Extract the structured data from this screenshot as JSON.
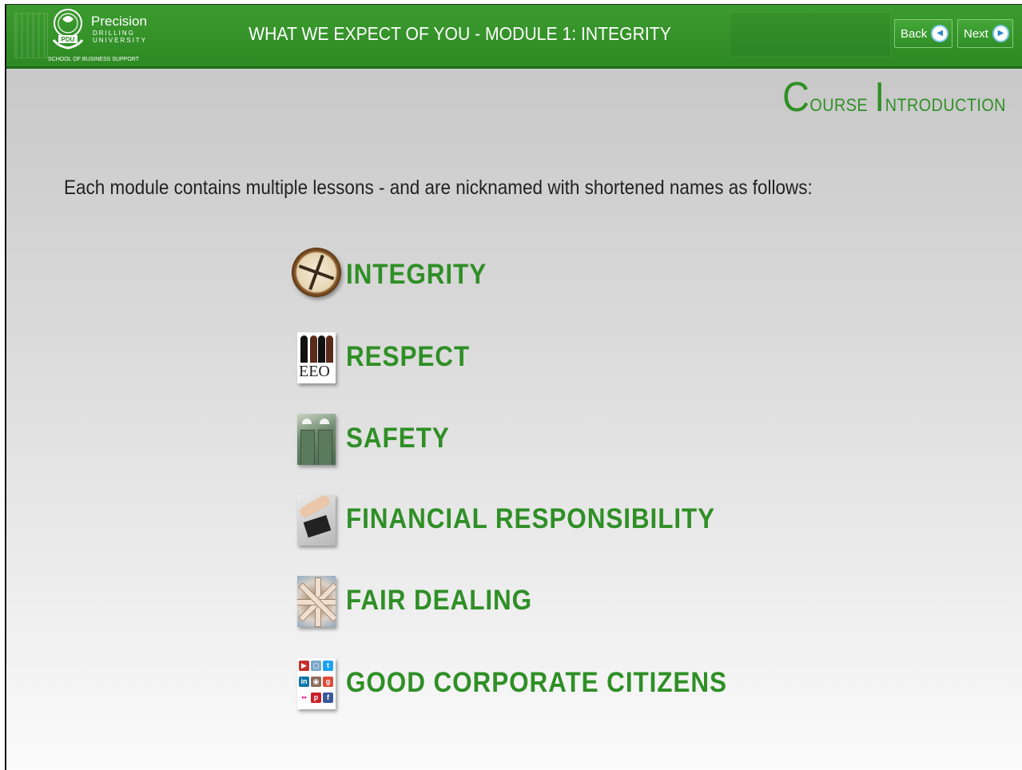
{
  "header": {
    "logo": {
      "name": "Precision",
      "line2": "DRILLING",
      "line3": "UNIVERSITY",
      "school": "SCHOOL OF BUSINESS SUPPORT",
      "seal_text": "PDU"
    },
    "title": "WHAT WE EXPECT OF YOU - MODULE 1: INTEGRITY",
    "back_label": "Back",
    "next_label": "Next"
  },
  "content": {
    "section_title": {
      "first_initial": "C",
      "first_rest": "ourse",
      "second_initial": "I",
      "second_rest": "ntroduction"
    },
    "intro": "Each module contains multiple lessons - and are nicknamed with shortened names as follows:",
    "lessons": [
      {
        "label": "INTEGRITY",
        "icon": "compass-icon"
      },
      {
        "label": "RESPECT",
        "icon": "eeo-icon",
        "icon_text": "EEO"
      },
      {
        "label": "SAFETY",
        "icon": "safety-workers-icon"
      },
      {
        "label": "FINANCIAL RESPONSIBILITY",
        "icon": "calculator-icon"
      },
      {
        "label": "FAIR DEALING",
        "icon": "joined-hands-icon"
      },
      {
        "label": "GOOD CORPORATE CITIZENS",
        "icon": "social-media-icon"
      }
    ]
  },
  "colors": {
    "header_green": "#2e8a24",
    "label_green": "#2f8f26",
    "text_dark": "#222222"
  }
}
